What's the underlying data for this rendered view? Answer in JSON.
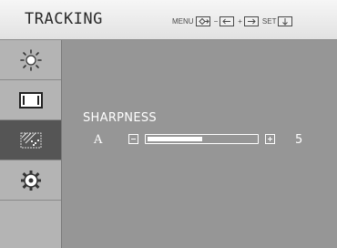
{
  "header": {
    "title": "TRACKING",
    "hints": [
      {
        "label": "MENU",
        "icon": "exit-icon"
      },
      {
        "label": "−",
        "icon": "left-arrow-icon"
      },
      {
        "label": "+",
        "icon": "right-arrow-icon"
      },
      {
        "label": "SET",
        "icon": "down-arrow-icon"
      }
    ]
  },
  "sidebar": {
    "items": [
      {
        "name": "brightness",
        "icon": "sun-icon",
        "active": false
      },
      {
        "name": "picture",
        "icon": "screen-icon",
        "active": false
      },
      {
        "name": "tracking",
        "icon": "tracking-icon",
        "active": true
      },
      {
        "name": "setup",
        "icon": "gear-icon",
        "active": false
      }
    ]
  },
  "setting": {
    "label": "SHARPNESS",
    "mode": "A",
    "value": "5",
    "level_fraction": 0.5
  },
  "colors": {
    "background": "#969696",
    "header": "#e6e6e6",
    "sidebar": "#b4b4b4",
    "active": "#555555",
    "text": "#ffffff"
  }
}
